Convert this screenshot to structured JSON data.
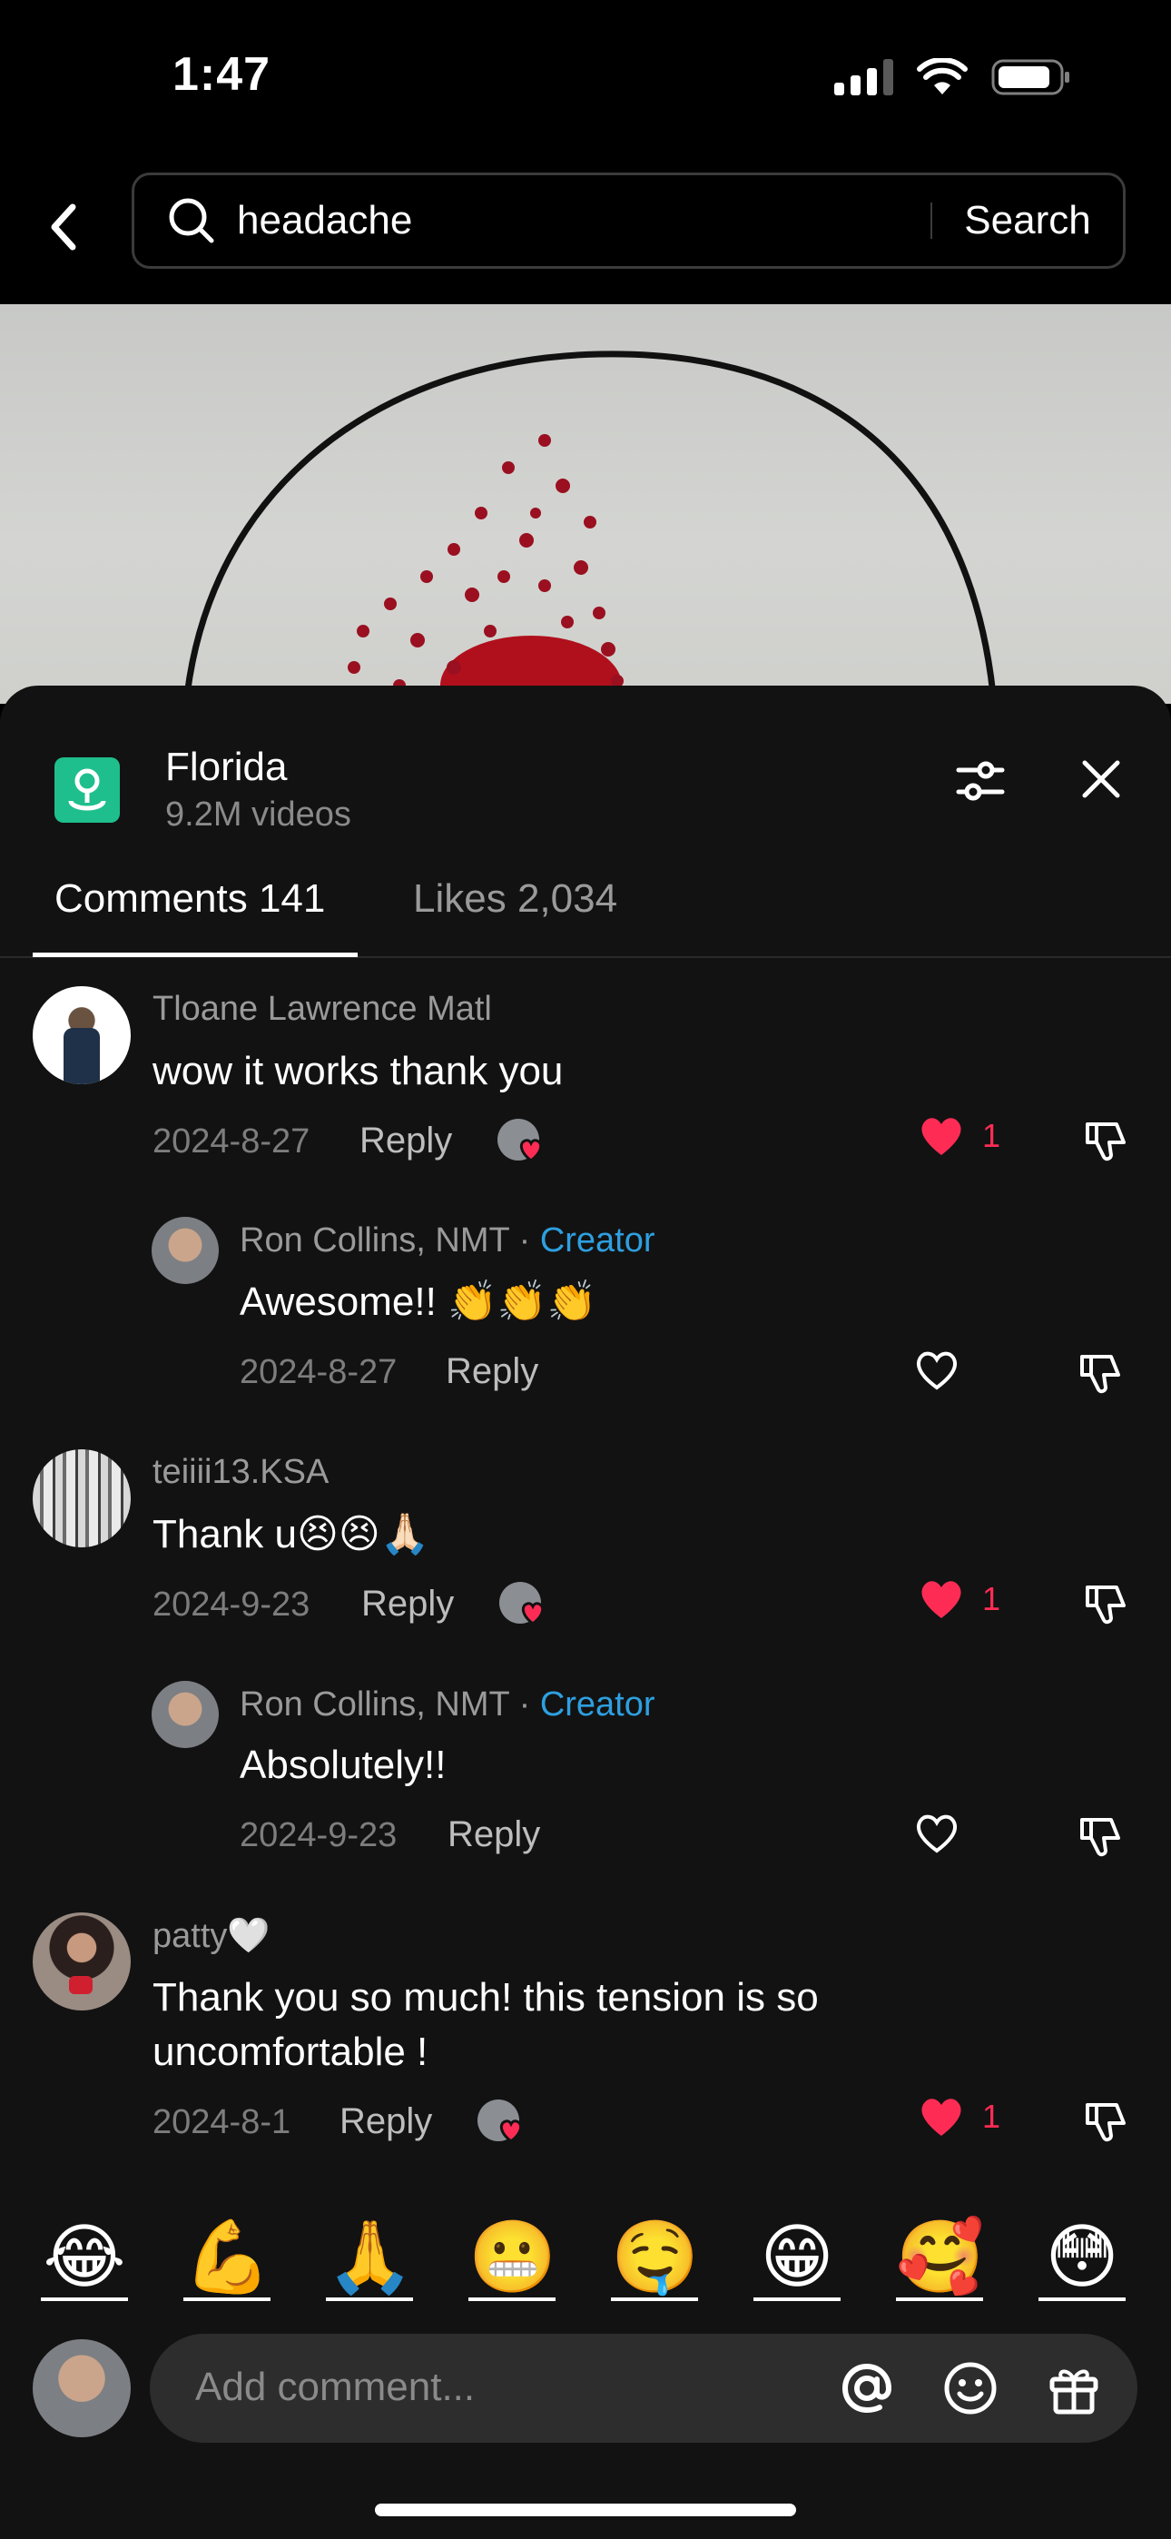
{
  "status_bar": {
    "time": "1:47"
  },
  "search": {
    "query": "headache",
    "button_label": "Search"
  },
  "location": {
    "name": "Florida",
    "count": "9.2M videos"
  },
  "tabs": {
    "comments": "Comments 141",
    "likes": "Likes 2,034"
  },
  "comments": [
    {
      "user": "Tloane Lawrence Matl",
      "text": "wow it works thank you",
      "date": "2024-8-27",
      "reply": "Reply",
      "likes": "1"
    },
    {
      "user": "Ron Collins, NMT · ",
      "creator": "Creator",
      "text": "Awesome!! 👏👏👏",
      "date": "2024-8-27",
      "reply": "Reply"
    },
    {
      "user": "teiiii13.KSA",
      "text": "Thank u😣😣🙏🏻",
      "date": "2024-9-23",
      "reply": "Reply",
      "likes": "1"
    },
    {
      "user": "Ron Collins, NMT · ",
      "creator": "Creator",
      "text": "Absolutely!!",
      "date": "2024-9-23",
      "reply": "Reply"
    },
    {
      "user": "patty🤍",
      "text_line1": "Thank you so much! this tension is so",
      "text_line2": "uncomfortable !",
      "date": "2024-8-1",
      "reply": "Reply",
      "likes": "1"
    }
  ],
  "emoji_bar": [
    "😂",
    "💪",
    "🙏",
    "😬",
    "🤤",
    "😁",
    "🥰",
    "😳"
  ],
  "input": {
    "placeholder": "Add comment..."
  },
  "colors": {
    "accent_red": "#fe2c55",
    "creator_blue": "#2e9fe0",
    "location_green": "#1fbf8d"
  }
}
